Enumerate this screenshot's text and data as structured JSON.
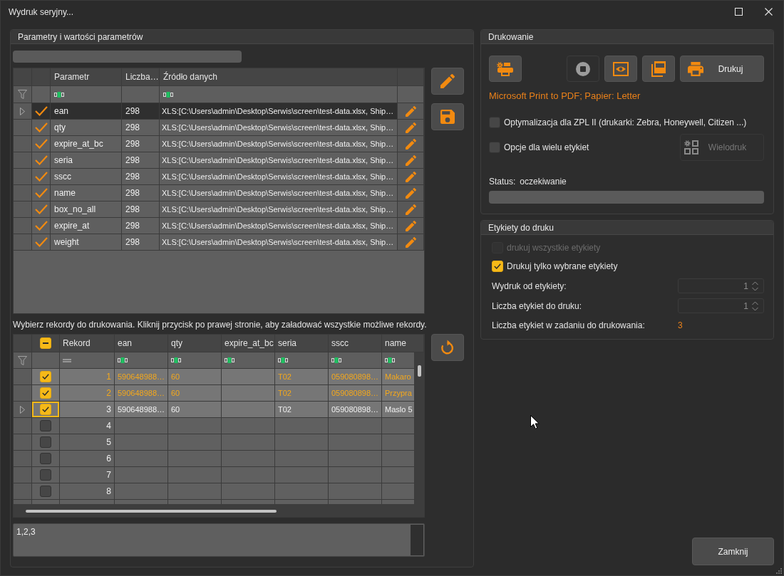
{
  "window": {
    "title": "Wydruk seryjny..."
  },
  "parameters": {
    "title": "Parametry i wartości parametrów",
    "loading": {
      "level": 0
    },
    "table": {
      "columns": [
        "Parametr",
        "Liczba…",
        "Źródło danych"
      ],
      "rows": [
        {
          "name": "ean",
          "count": "298",
          "source": "XLS:[C:\\Users\\admin\\Desktop\\Serwis\\screen\\test-data.xlsx, Ship…",
          "checked": true,
          "current": true
        },
        {
          "name": "qty",
          "count": "298",
          "source": "XLS:[C:\\Users\\admin\\Desktop\\Serwis\\screen\\test-data.xlsx, Ship…",
          "checked": true,
          "current": false
        },
        {
          "name": "expire_at_bc",
          "count": "298",
          "source": "XLS:[C:\\Users\\admin\\Desktop\\Serwis\\screen\\test-data.xlsx, Ship…",
          "checked": true,
          "current": false
        },
        {
          "name": "seria",
          "count": "298",
          "source": "XLS:[C:\\Users\\admin\\Desktop\\Serwis\\screen\\test-data.xlsx, Ship…",
          "checked": true,
          "current": false
        },
        {
          "name": "sscc",
          "count": "298",
          "source": "XLS:[C:\\Users\\admin\\Desktop\\Serwis\\screen\\test-data.xlsx, Ship…",
          "checked": true,
          "current": false
        },
        {
          "name": "name",
          "count": "298",
          "source": "XLS:[C:\\Users\\admin\\Desktop\\Serwis\\screen\\test-data.xlsx, Ship…",
          "checked": true,
          "current": false
        },
        {
          "name": "box_no_all",
          "count": "298",
          "source": "XLS:[C:\\Users\\admin\\Desktop\\Serwis\\screen\\test-data.xlsx, Ship…",
          "checked": true,
          "current": false
        },
        {
          "name": "expire_at",
          "count": "298",
          "source": "XLS:[C:\\Users\\admin\\Desktop\\Serwis\\screen\\test-data.xlsx, Ship…",
          "checked": true,
          "current": false
        },
        {
          "name": "weight",
          "count": "298",
          "source": "XLS:[C:\\Users\\admin\\Desktop\\Serwis\\screen\\test-data.xlsx, Ship…",
          "checked": true,
          "current": false
        }
      ]
    }
  },
  "records": {
    "instruction": "Wybierz rekordy do drukowania. Kliknij przycisk po prawej stronie, aby załadować wszystkie możliwe rekordy.",
    "table": {
      "select_all": {
        "indeterminate": true
      },
      "columns": [
        "Rekord",
        "ean",
        "qty",
        "expire_at_bc",
        "seria",
        "sscc",
        "name"
      ],
      "rows": [
        {
          "record": "1",
          "cells": [
            "590648988…",
            "60",
            null,
            "T02",
            "059080898…",
            "Makaro"
          ],
          "checked": true,
          "selected": true,
          "current": false
        },
        {
          "record": "2",
          "cells": [
            "590648988…",
            "60",
            null,
            "T02",
            "059080898…",
            "Przypra"
          ],
          "checked": true,
          "selected": true,
          "current": false
        },
        {
          "record": "3",
          "cells": [
            "590648988…",
            "60",
            null,
            "T02",
            "059080898…",
            "Maslo 5"
          ],
          "checked": true,
          "selected": false,
          "current": true
        },
        {
          "record": "4",
          "checked": false,
          "selected": false,
          "current": false
        },
        {
          "record": "5",
          "checked": false,
          "selected": false,
          "current": false
        },
        {
          "record": "6",
          "checked": false,
          "selected": false,
          "current": false
        },
        {
          "record": "7",
          "checked": false,
          "selected": false,
          "current": false
        },
        {
          "record": "8",
          "checked": false,
          "selected": false,
          "current": false
        }
      ]
    },
    "selection": {
      "value": "1,2,3"
    }
  },
  "printing": {
    "title": "Drukowanie",
    "toolbar": [
      {
        "kind": "settings",
        "disabled": false
      },
      {
        "kind": "stop",
        "disabled": true
      },
      {
        "kind": "preview",
        "disabled": false
      },
      {
        "kind": "pdf",
        "disabled": false
      },
      {
        "kind": "print",
        "label": "Drukuj",
        "disabled": false
      }
    ],
    "printer_info": "Microsoft Print to PDF; Papier: Letter",
    "options": [
      {
        "label": "Optymalizacja dla ZPL II (drukarki: Zebra, Honeywell, Citizen ...)",
        "checked": false
      },
      {
        "label": "Opcje dla wielu etykiet",
        "checked": false
      }
    ],
    "multi_print_button": {
      "label": "Wielodruk",
      "disabled": true
    },
    "status": {
      "label": "Status:",
      "value": "oczekiwanie"
    },
    "progress": {
      "level": 0
    }
  },
  "labels": {
    "title": "Etykiety do druku",
    "options": [
      {
        "label": "drukuj wszystkie etykiety",
        "checked": false,
        "disabled": true
      },
      {
        "label": "Drukuj tylko wybrane etykiety",
        "checked": true,
        "disabled": false
      }
    ],
    "fields": [
      {
        "label": "Wydruk od etykiety:",
        "value": "1",
        "disabled": true
      },
      {
        "label": "Liczba etykiet do druku:",
        "value": "1",
        "disabled": true
      }
    ],
    "total": {
      "label": "Liczba etykiet w zadaniu do drukowania:",
      "value": "3"
    }
  },
  "close_button": {
    "label": "Zamknij"
  }
}
